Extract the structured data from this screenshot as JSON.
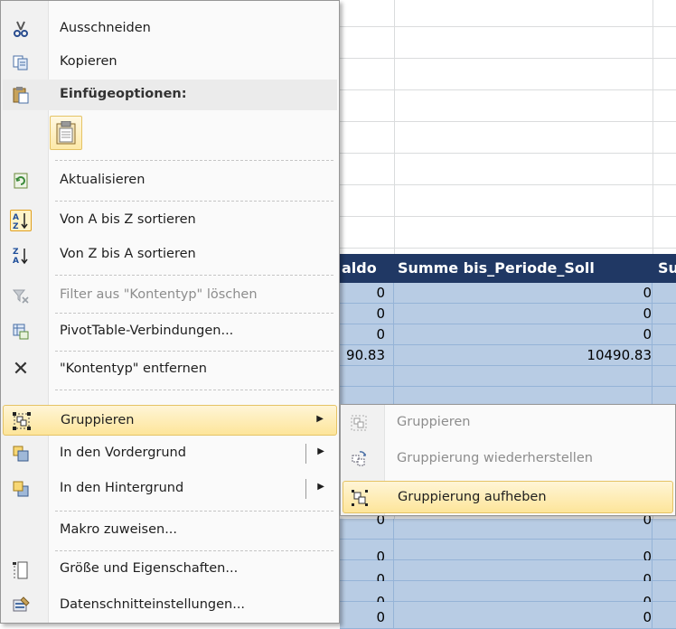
{
  "pivot": {
    "header_col1": "aldo",
    "header_col2": "Summe bis_Periode_Soll",
    "header_col3": "Su",
    "rows": [
      {
        "c1": "0",
        "c2": "0"
      },
      {
        "c1": "0",
        "c2": "0"
      },
      {
        "c1": "0",
        "c2": "0"
      },
      {
        "c1": "90.83",
        "c2": "10490.83"
      },
      {
        "c1": "",
        "c2": ""
      },
      {
        "c1": "",
        "c2": ""
      },
      {
        "c1": "",
        "c2": ""
      },
      {
        "c1": "0",
        "c2": "0"
      },
      {
        "c1": "0",
        "c2": "0"
      },
      {
        "c1": "0",
        "c2": "0"
      },
      {
        "c1": "0",
        "c2": "0"
      },
      {
        "c1": "0",
        "c2": "0"
      }
    ]
  },
  "menu": {
    "cut": {
      "label": "Ausschneiden",
      "icon": "scissors-icon"
    },
    "copy": {
      "label": "Kopieren",
      "icon": "copy-icon"
    },
    "paste_options": {
      "label": "Einfügeoptionen:",
      "icon": "paste-icon"
    },
    "refresh": {
      "label": "Aktualisieren",
      "icon": "refresh-icon"
    },
    "sort_az": {
      "label": "Von A bis Z sortieren",
      "icon": "sort-ascending-icon"
    },
    "sort_za": {
      "label": "Von Z bis A sortieren",
      "icon": "sort-descending-icon"
    },
    "clear_filter": {
      "label": "Filter aus \"Kontentyp\" löschen",
      "icon": "clear-filter-icon"
    },
    "pivot_connections": {
      "label": "PivotTable-Verbindungen...",
      "icon": "pivot-connections-icon"
    },
    "remove_field": {
      "label": "\"Kontentyp\" entfernen",
      "icon": "remove-x-icon"
    },
    "group": {
      "label": "Gruppieren",
      "icon": "group-icon"
    },
    "bring_front": {
      "label": "In den Vordergrund",
      "icon": "bring-front-icon"
    },
    "send_back": {
      "label": "In den Hintergrund",
      "icon": "send-back-icon"
    },
    "assign_macro": {
      "label": "Makro zuweisen..."
    },
    "size_props": {
      "label": "Größe und Eigenschaften...",
      "icon": "size-properties-icon"
    },
    "slicer_settings": {
      "label": "Datenschnitteinstellungen...",
      "icon": "slicer-settings-icon"
    }
  },
  "submenu": {
    "group": {
      "label": "Gruppieren",
      "icon": "group-icon"
    },
    "regroup": {
      "label": "Gruppierung wiederherstellen",
      "icon": "regroup-icon"
    },
    "ungroup": {
      "label": "Gruppierung aufheben",
      "icon": "ungroup-icon"
    }
  },
  "colors": {
    "pivot_header": "#203864",
    "pivot_row": "#b8cce4",
    "highlight_top": "#fff5d6",
    "highlight_bottom": "#fde59a"
  }
}
